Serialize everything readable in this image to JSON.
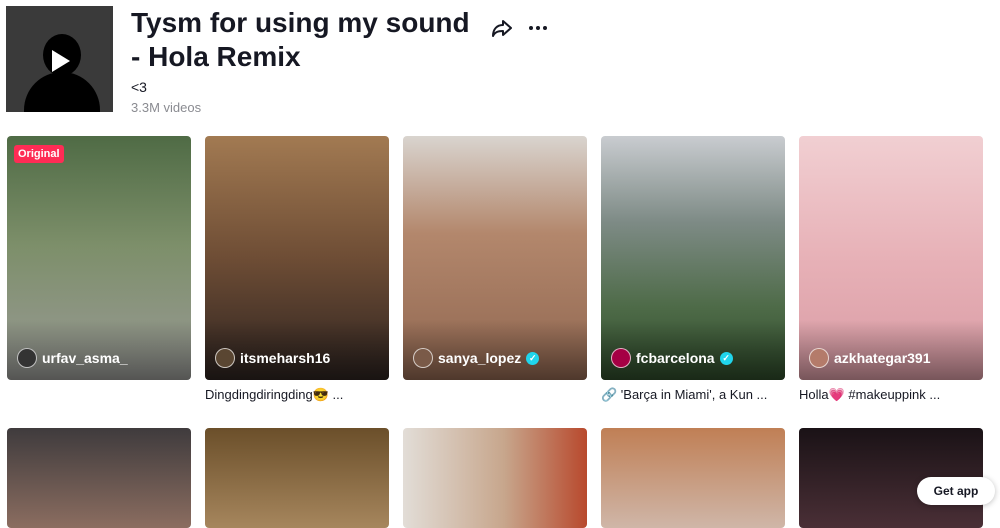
{
  "sound": {
    "title": "Tysm for using my sound - Hola Remix",
    "subtitle": "<3",
    "video_count": "3.3M videos",
    "cover_icon": "play-icon"
  },
  "header_actions": {
    "share_icon": "share-icon",
    "more_icon": "more-icon"
  },
  "videos": [
    {
      "author": "urfav_asma_",
      "verified": false,
      "badge": "Original",
      "caption": "",
      "color": "#6f7d5c"
    },
    {
      "author": "itsmeharsh16",
      "verified": false,
      "badge": "",
      "caption": "Dingdingdiringding😎 ...",
      "color": "#8c6947"
    },
    {
      "author": "sanya_lopez",
      "verified": true,
      "badge": "",
      "caption": "",
      "color": "#b08a73"
    },
    {
      "author": "fcbarcelona",
      "verified": true,
      "badge": "",
      "caption": "🔗 'Barça in Miami', a Kun ...",
      "color": "#5c7a55"
    },
    {
      "author": "azkhategar391",
      "verified": false,
      "badge": "",
      "caption": "Holla💗  #makeuppink ...",
      "color": "#e8b3b8"
    }
  ],
  "videos_row2": [
    {
      "color": "#6b5b55"
    },
    {
      "color": "#8a6a3c"
    },
    {
      "color": "#c9b39a"
    },
    {
      "color": "#b79d8c"
    },
    {
      "color": "#2b1f25"
    }
  ],
  "get_app": "Get app"
}
